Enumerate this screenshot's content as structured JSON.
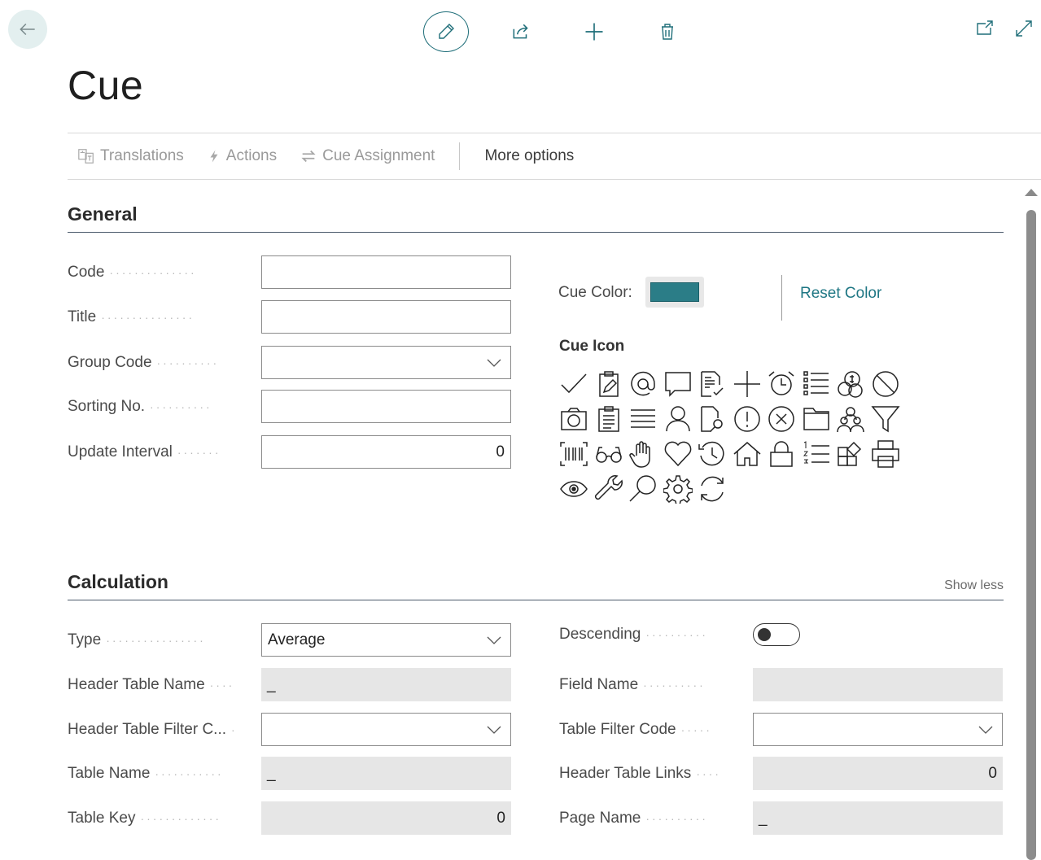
{
  "header": {
    "page_title": "Cue"
  },
  "actionbar": {
    "translations": "Translations",
    "actions": "Actions",
    "cue_assignment": "Cue Assignment",
    "more_options": "More options"
  },
  "general": {
    "title": "General",
    "fields": [
      {
        "label": "Code",
        "value": ""
      },
      {
        "label": "Title",
        "value": ""
      },
      {
        "label": "Group Code",
        "value": ""
      },
      {
        "label": "Sorting No.",
        "value": ""
      },
      {
        "label": "Update Interval",
        "value": "0"
      }
    ],
    "cue_color_label": "Cue Color:",
    "cue_color": "#2b7d87",
    "reset_color": "Reset Color",
    "cue_icon_title": "Cue Icon",
    "icons": [
      "checkmark-icon",
      "clipboard-edit-icon",
      "at-sign-icon",
      "comment-icon",
      "document-check-icon",
      "plus-icon",
      "alarm-clock-icon",
      "bulleted-list-icon",
      "coins-icon",
      "block-icon",
      "camera-icon",
      "clipboard-icon",
      "lines-icon",
      "person-icon",
      "document-search-icon",
      "warning-circle-icon",
      "cancel-circle-icon",
      "folder-icon",
      "people-icon",
      "filter-icon",
      "barcode-icon",
      "glasses-icon",
      "hand-icon",
      "heart-icon",
      "history-icon",
      "home-icon",
      "lock-icon",
      "numbered-list-icon",
      "add-apps-icon",
      "print-icon",
      "eye-icon",
      "wrench-icon",
      "magnifier-icon",
      "settings-icon",
      "refresh-icon"
    ]
  },
  "calculation": {
    "title": "Calculation",
    "show_less": "Show less",
    "left_fields": [
      {
        "label": "Type",
        "value": "Average"
      },
      {
        "label": "Header Table Name",
        "value": "_"
      },
      {
        "label": "Header Table Filter C...",
        "value": ""
      },
      {
        "label": "Table Name",
        "value": "_"
      },
      {
        "label": "Table Key",
        "value": "0"
      }
    ],
    "right_fields": [
      {
        "label": "Descending",
        "value": ""
      },
      {
        "label": "Field Name",
        "value": ""
      },
      {
        "label": "Table Filter Code",
        "value": ""
      },
      {
        "label": "Header Table Links",
        "value": "0"
      },
      {
        "label": "Page Name",
        "value": "_"
      }
    ]
  }
}
